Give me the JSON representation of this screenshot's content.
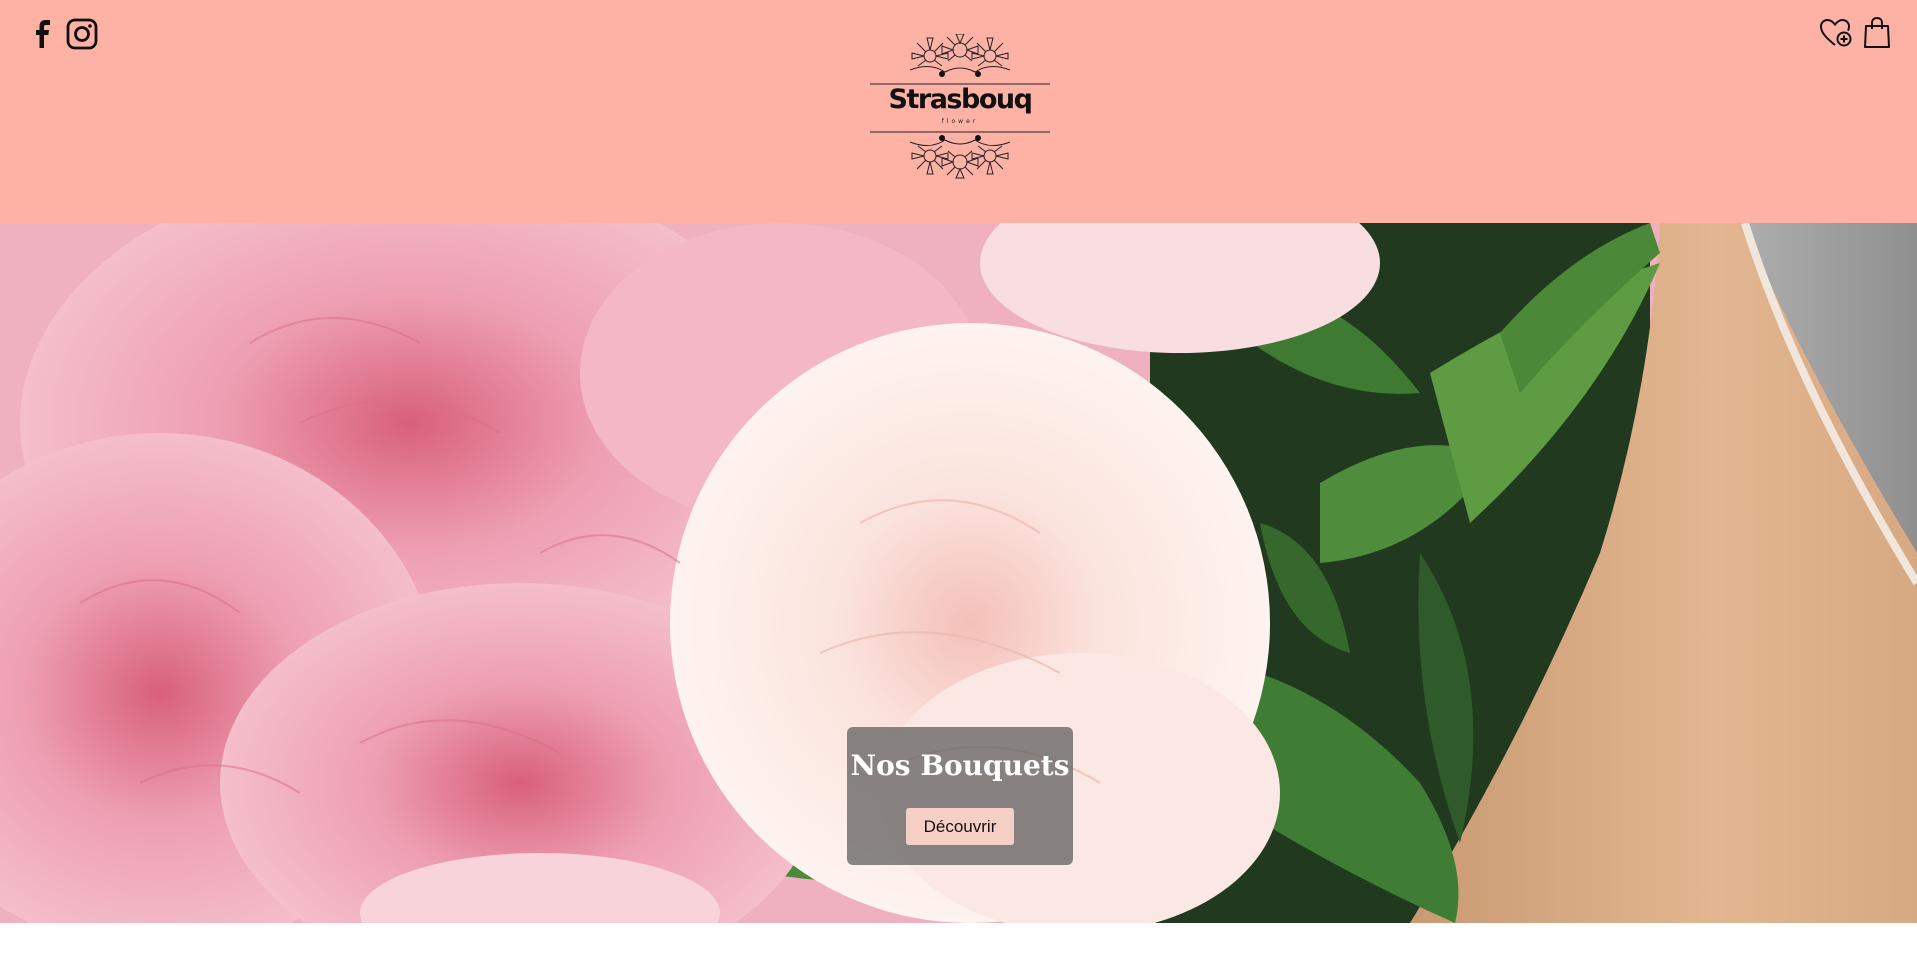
{
  "header": {
    "social": [
      {
        "icon": "facebook-icon"
      },
      {
        "icon": "instagram-icon"
      }
    ],
    "brand": {
      "name": "Strasbouq",
      "tagline": "flower"
    },
    "actions": [
      {
        "icon": "wishlist-heart-icon"
      },
      {
        "icon": "shopping-bag-icon"
      }
    ]
  },
  "hero": {
    "title": "Nos Bouquets",
    "button_label": "Découvrir",
    "image": "pink peonies bouquet in kraft paper"
  },
  "colors": {
    "header_bg": "#fdb2a5",
    "cta_overlay": "rgba(90,90,90,0.72)",
    "cta_button_bg": "#f6cfc7"
  }
}
